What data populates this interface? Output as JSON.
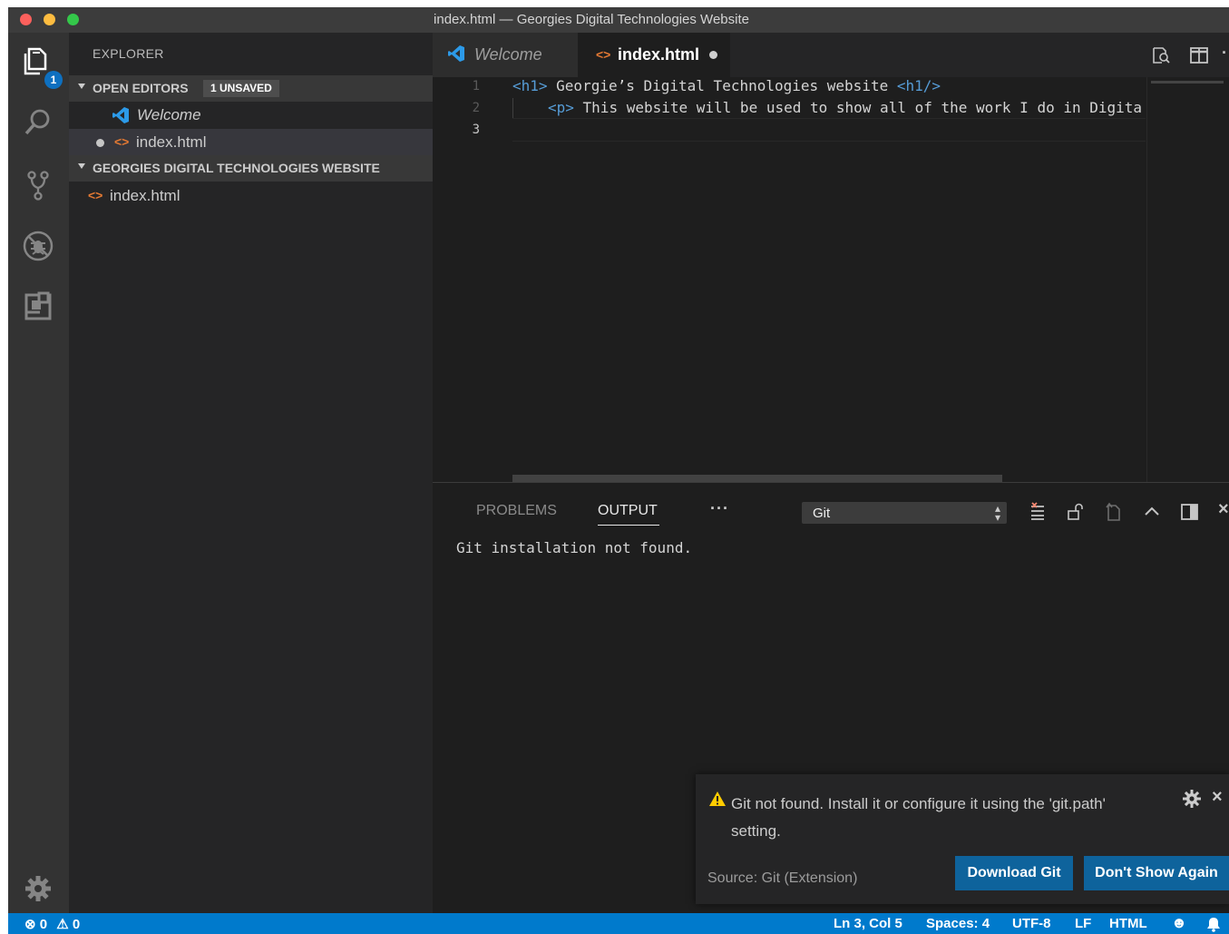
{
  "window": {
    "title": "index.html — Georgies Digital Technologies Website"
  },
  "activity_bar": {
    "explorer_badge": "1",
    "items": [
      "explorer-icon",
      "search-icon",
      "source-control-icon",
      "debug-icon",
      "extensions-icon",
      "gear-icon"
    ]
  },
  "sidebar": {
    "title": "EXPLORER",
    "open_editors": {
      "label": "OPEN EDITORS",
      "badge": "1 UNSAVED",
      "items": [
        {
          "label": "Welcome"
        },
        {
          "label": "index.html"
        }
      ]
    },
    "folder": {
      "label": "GEORGIES DIGITAL TECHNOLOGIES WEBSITE",
      "items": [
        {
          "label": "index.html"
        }
      ]
    }
  },
  "editor": {
    "tabs": [
      {
        "label": "Welcome"
      },
      {
        "label": "index.html"
      }
    ],
    "line_numbers": [
      "1",
      "2",
      "3"
    ],
    "lines": [
      {
        "open_tag": "<h1>",
        "text": " Georgie’s Digital Technologies website ",
        "close_tag": "<h1/>"
      },
      {
        "open_tag": "<p>",
        "text": " This website will be used to show all of the work I do in Digita"
      },
      {
        "text": ""
      }
    ]
  },
  "panel": {
    "tabs": {
      "problems": "PROBLEMS",
      "output": "OUTPUT",
      "more": "···"
    },
    "channel_select": "Git",
    "output_text": "Git installation not found."
  },
  "notification": {
    "message": "Git not found. Install it or configure it using the 'git.path' setting.",
    "source": "Source: Git (Extension)",
    "buttons": {
      "download": "Download Git",
      "dont_show": "Don't Show Again"
    }
  },
  "status_bar": {
    "errors": "0",
    "warnings": "0",
    "position": "Ln 3, Col 5",
    "spaces": "Spaces: 4",
    "encoding": "UTF-8",
    "eol": "LF",
    "language": "HTML"
  }
}
